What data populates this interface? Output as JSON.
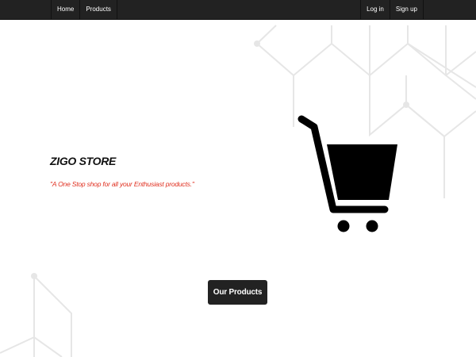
{
  "navbar": {
    "left_items": [
      {
        "label": "Home"
      },
      {
        "label": "Products"
      }
    ],
    "right_items": [
      {
        "label": "Log in"
      },
      {
        "label": "Sign up"
      }
    ]
  },
  "hero": {
    "title": "ZIGO STORE",
    "tagline": "\"A One Stop shop for all your Enthusiast products.\"",
    "image_icon": "shopping-cart-icon"
  },
  "cta": {
    "label": "Our Products"
  },
  "colors": {
    "navbar_background": "#222222",
    "tagline": "#e03020",
    "button_background": "#222222",
    "pattern_lines": "#e6e6e6"
  }
}
